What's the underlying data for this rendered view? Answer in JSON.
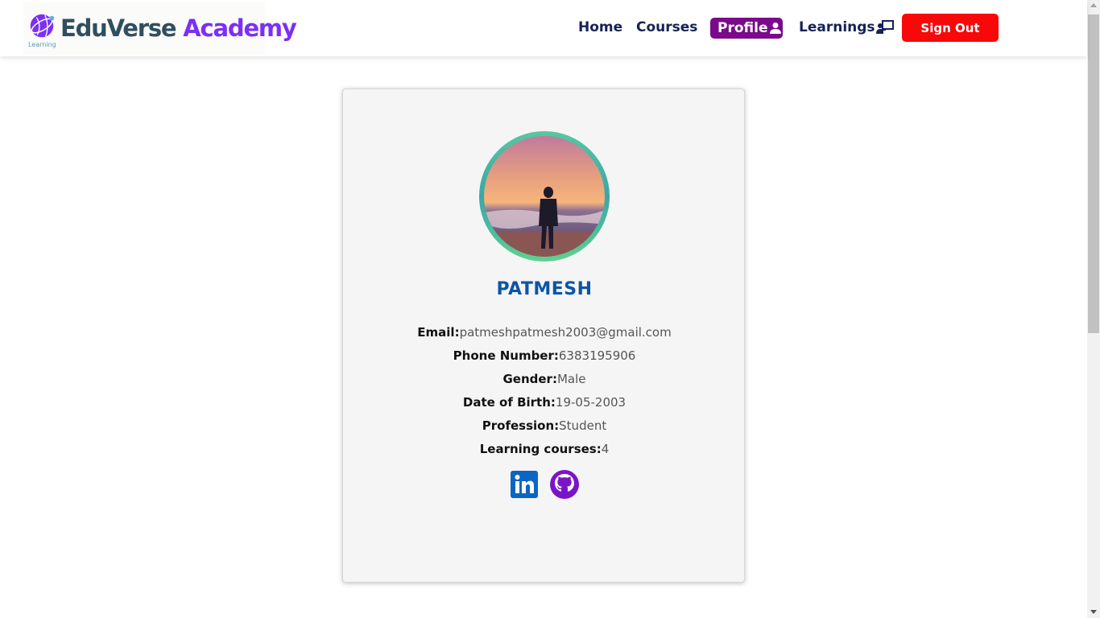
{
  "brand": {
    "name_part1": "EduVerse",
    "name_part2": "Academy",
    "tagline": "Learning",
    "color_name": "#2f4f5f",
    "color_accent": "#7b2ff7"
  },
  "nav": {
    "home": "Home",
    "courses": "Courses",
    "profile": "Profile",
    "learnings": "Learnings",
    "sign_out": "Sign Out",
    "active_color": "#7a0a8a",
    "sign_out_color": "#f80808"
  },
  "profile": {
    "name": "PATMESH",
    "details": [
      {
        "label": "Email:",
        "value": "patmeshpatmesh2003@gmail.com"
      },
      {
        "label": "Phone Number:",
        "value": "6383195906"
      },
      {
        "label": "Gender:",
        "value": "Male"
      },
      {
        "label": "Date of Birth:",
        "value": "19-05-2003"
      },
      {
        "label": "Profession:",
        "value": "Student"
      },
      {
        "label": "Learning courses:",
        "value": "4"
      }
    ],
    "socials": [
      {
        "icon": "linkedin-icon",
        "color": "#0a66c2"
      },
      {
        "icon": "github-icon",
        "color": "#7a14c9"
      }
    ]
  }
}
